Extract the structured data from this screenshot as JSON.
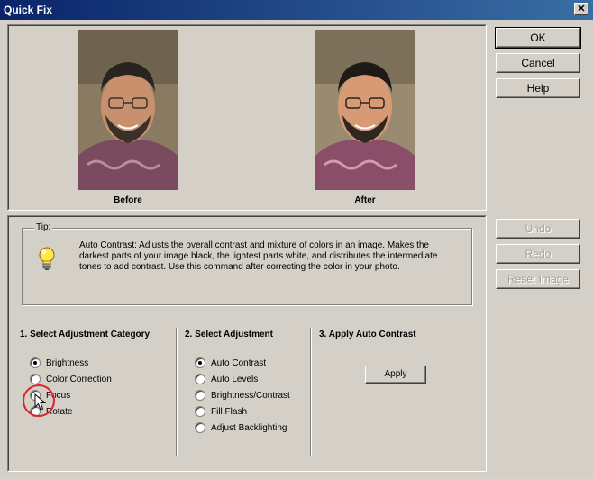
{
  "window": {
    "title": "Quick Fix",
    "close_glyph": "✕"
  },
  "buttons": {
    "ok": "OK",
    "cancel": "Cancel",
    "help": "Help",
    "undo": "Undo",
    "redo": "Redo",
    "reset": "Reset Image"
  },
  "preview": {
    "before_label": "Before",
    "after_label": "After"
  },
  "tip": {
    "label": "Tip:",
    "text": "Auto Contrast: Adjusts the overall  contrast and mixture of colors in an image.  Makes the darkest parts of your  image black, the lightest parts white, and distributes the intermediate tones to  add contrast. Use this command after correcting the color in your  photo."
  },
  "category": {
    "heading": "1. Select Adjustment Category",
    "options": [
      "Brightness",
      "Color Correction",
      "Focus",
      "Rotate"
    ],
    "selected": "Brightness"
  },
  "adjustment": {
    "heading": "2. Select Adjustment",
    "options": [
      "Auto Contrast",
      "Auto Levels",
      "Brightness/Contrast",
      "Fill Flash",
      "Adjust Backlighting"
    ],
    "selected": "Auto Contrast"
  },
  "apply_section": {
    "heading": "3. Apply Auto Contrast",
    "apply_label": "Apply"
  },
  "icons": {
    "tip": "lightbulb-icon",
    "cursor": "mouse-pointer-icon",
    "highlight": "red-circle-highlight"
  },
  "colors": {
    "title_start": "#0a246a",
    "title_end": "#3a6ea5",
    "face": "#d4d0c8",
    "highlight": "#e0202a"
  }
}
